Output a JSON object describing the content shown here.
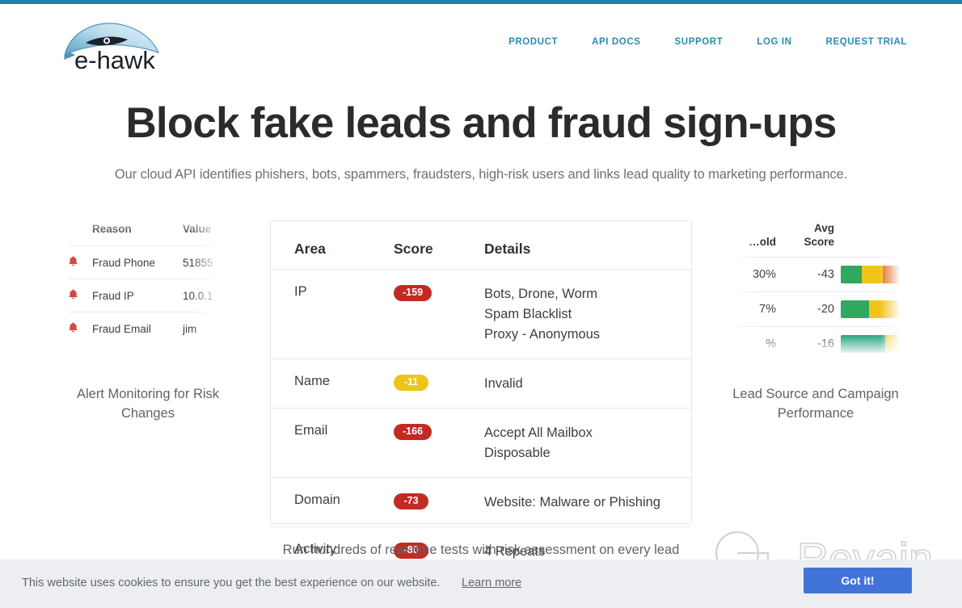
{
  "theme": {
    "accent_blue": "#1b81ad",
    "nav_link_color": "#2a8bb0",
    "badge_red": "#c32a24",
    "badge_yellow": "#edc418",
    "bar_green": "#30a860",
    "bar_yellow": "#f0c419",
    "bar_orange": "#e0671e",
    "cookie_button": "#4274d8"
  },
  "header": {
    "logo_text": "e-hawk",
    "nav": [
      {
        "label": "PRODUCT"
      },
      {
        "label": "API DOCS"
      },
      {
        "label": "SUPPORT"
      },
      {
        "label": "LOG IN"
      },
      {
        "label": "REQUEST TRIAL"
      }
    ]
  },
  "hero": {
    "title": "Block fake leads and fraud sign-ups",
    "subtitle": "Our cloud API identifies phishers, bots, spammers, fraudsters, high-risk users and links lead quality to marketing performance."
  },
  "left_panel": {
    "caption": "Alert Monitoring for Risk Changes",
    "columns": [
      "Reason",
      "Value"
    ],
    "rows": [
      {
        "icon": "bell-icon",
        "reason": "Fraud Phone",
        "value": "51855"
      },
      {
        "icon": "bell-icon",
        "reason": "Fraud IP",
        "value": "10.0.1"
      },
      {
        "icon": "bell-icon",
        "reason": "Fraud Email",
        "value": "jim"
      }
    ]
  },
  "center_card": {
    "columns": [
      "Area",
      "Score",
      "Details"
    ],
    "rows": [
      {
        "area": "IP",
        "score": "-159",
        "score_color": "red",
        "details": "Bots, Drone, Worm\nSpam Blacklist\nProxy - Anonymous"
      },
      {
        "area": "Name",
        "score": "-11",
        "score_color": "yellow",
        "details": "Invalid"
      },
      {
        "area": "Email",
        "score": "-166",
        "score_color": "red",
        "details": "Accept All Mailbox\nDisposable"
      },
      {
        "area": "Domain",
        "score": "-73",
        "score_color": "red",
        "details": "Website: Malware or Phishing"
      },
      {
        "area": "Activity",
        "score": "-80",
        "score_color": "red",
        "details": "4 Repeats"
      }
    ],
    "caption": "Run hundreds of real-time tests with risk assessment on every lead"
  },
  "right_panel": {
    "caption": "Lead Source and Campaign Performance",
    "columns": [
      "…old",
      "Avg Score",
      ""
    ],
    "rows": [
      {
        "threshold": "30%",
        "avg_score": "-43",
        "segments": [
          {
            "color": "#30a860",
            "pct": 36
          },
          {
            "color": "#f0c419",
            "pct": 36
          },
          {
            "color": "#e0671e",
            "pct": 28
          }
        ]
      },
      {
        "threshold": "7%",
        "avg_score": "-20",
        "segments": [
          {
            "color": "#30a860",
            "pct": 48
          },
          {
            "color": "#f0c419",
            "pct": 52
          }
        ]
      },
      {
        "threshold": "%",
        "avg_score": "-16",
        "segments": [
          {
            "color": "#1fa07a",
            "pct": 76
          },
          {
            "color": "#f0c419",
            "pct": 24
          }
        ]
      }
    ]
  },
  "watermark": {
    "text": "Revain"
  },
  "cookie_banner": {
    "message": "This website uses cookies to ensure you get the best experience on our website.",
    "link": "Learn more",
    "button": "Got it!"
  }
}
